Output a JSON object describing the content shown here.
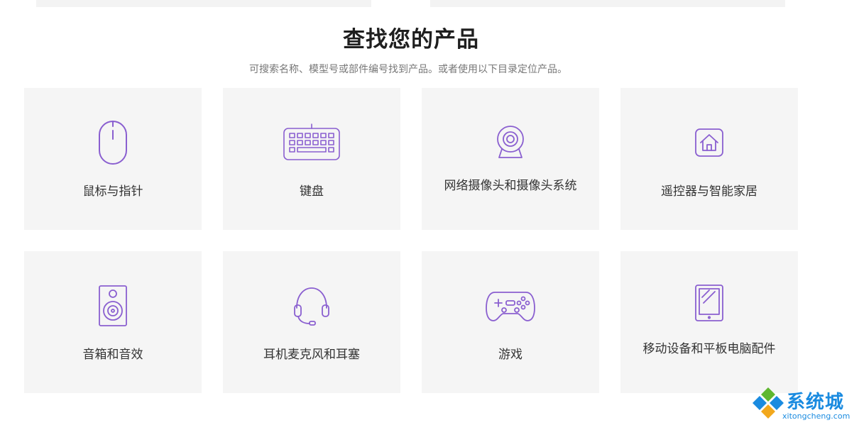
{
  "header": {
    "title": "查找您的产品",
    "subtitle": "可搜索名称、模型号或部件编号找到产品。或者使用以下目录定位产品。"
  },
  "categories": [
    {
      "label": "鼠标与指针",
      "icon": "mouse-icon"
    },
    {
      "label": "键盘",
      "icon": "keyboard-icon"
    },
    {
      "label": "网络摄像头和摄像头系统",
      "icon": "webcam-icon"
    },
    {
      "label": "遥控器与智能家居",
      "icon": "smart-home-icon"
    },
    {
      "label": "音箱和音效",
      "icon": "speaker-icon"
    },
    {
      "label": "耳机麦克风和耳塞",
      "icon": "headset-icon"
    },
    {
      "label": "游戏",
      "icon": "gamepad-icon"
    },
    {
      "label": "移动设备和平板电脑配件",
      "icon": "tablet-icon"
    }
  ],
  "watermark": {
    "brand": "系统城",
    "url": "xitongcheng.com"
  },
  "colors": {
    "accent": "#8a5fd0",
    "card_bg": "#f5f5f5",
    "watermark": "#1a8be0"
  }
}
